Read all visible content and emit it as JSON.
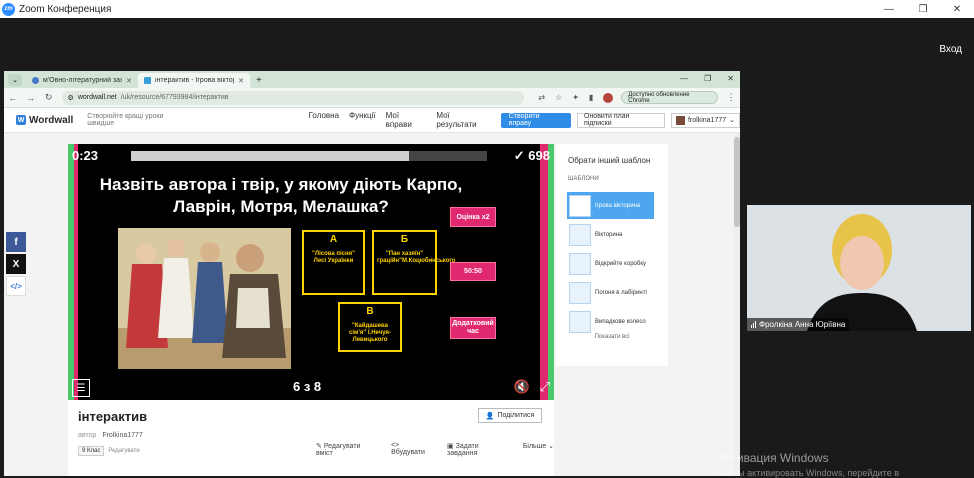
{
  "zoom": {
    "logo_text": "zm",
    "title": "Zoom Конференция",
    "login": "Вход",
    "ctrl_min": "—",
    "ctrl_max": "❐",
    "ctrl_close": "✕"
  },
  "browser": {
    "tabs": [
      {
        "title": "м'Овно-літературний захід до"
      },
      {
        "title": "інтерактив - Ігрова вікторина"
      }
    ],
    "url_prefix": "wordwall.net",
    "url_path": "/uk/resource/67793984/інтерактив",
    "update_label": "Доступно обновление Chrome"
  },
  "wordwall": {
    "logo": "Wordwall",
    "tagline": "Створюйте кращі уроки швидше",
    "nav": [
      "Головна",
      "Функції",
      "Мої вправи",
      "Мої результати"
    ],
    "create_button": "Створити вправу",
    "plan_button": "Оновити план підписки",
    "user": "frolkina1777"
  },
  "game": {
    "timer": "0:23",
    "progress_fraction": 0.78,
    "score": "✓ 698",
    "question": "Назвіть автора і твір, у якому діють Карпо, Лаврін, Мотря, Мелашка?",
    "answers": [
      {
        "letter": "А",
        "text": "\"Лісова пісня\" Лесі Українки"
      },
      {
        "letter": "Б",
        "text": "\"Пан хазяїн\" граційн\"М.Коцюбинського"
      },
      {
        "letter": "В",
        "text": "\"Кайдашева сім'я\" І.Нечуя-Левицького"
      }
    ],
    "powerups": [
      "Оцінка x2",
      "50:50",
      "Додатковий час"
    ],
    "page_counter": "6 з 8"
  },
  "activity": {
    "title": "інтерактив",
    "share_button": "Поділитися",
    "author_label": "автор",
    "author_name": "Frolkina1777",
    "grade": "9 Клас",
    "edit_link": "Редагувати",
    "actions": [
      "Редагувати вміст",
      "Вбудувати",
      "Задати завдання",
      "Більше"
    ]
  },
  "side_panel": {
    "title": "Обрати інший шаблон",
    "section": "ШАБЛОНИ",
    "templates": [
      {
        "label": "Ігрова вікторина",
        "active": true
      },
      {
        "label": "Вікторина",
        "active": false
      },
      {
        "label": "Відкрийте коробку",
        "active": false
      },
      {
        "label": "Погоня в лабіринті",
        "active": false
      },
      {
        "label": "Випадкове колесо",
        "active": false
      }
    ],
    "show_all": "Показати всі"
  },
  "participant": {
    "name": "Фролкіна Анна Юріївна"
  },
  "windows": {
    "activation_title": "Активация Windows",
    "activation_sub": "Чтобы активировать Windows, перейдите в"
  }
}
